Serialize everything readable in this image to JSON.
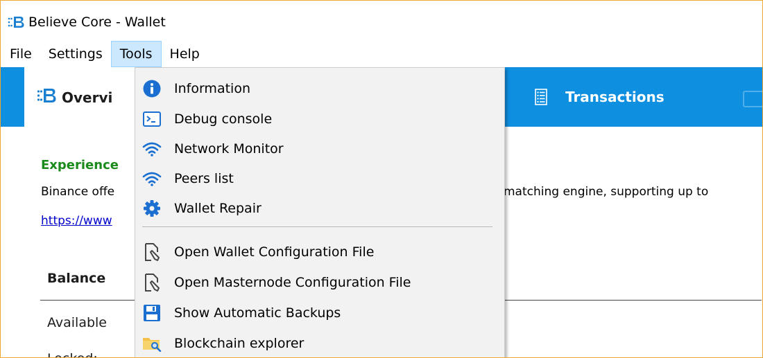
{
  "window": {
    "title": "Believe Core - Wallet"
  },
  "menubar": {
    "items": [
      {
        "label": "File"
      },
      {
        "label": "Settings"
      },
      {
        "label": "Tools"
      },
      {
        "label": "Help"
      }
    ]
  },
  "toolbar": {
    "overview_label": "Overvi",
    "transactions_label": "Transactions"
  },
  "content": {
    "promo_title": "Experience",
    "promo_text_left": "Binance offe",
    "promo_text_right": "matching engine, supporting up to",
    "promo_link": "https://www",
    "balance_header": "Balance",
    "available_label": "Available",
    "locked_label": "Locked:"
  },
  "tools_menu": {
    "items": [
      {
        "label": "Information",
        "icon": "info-icon"
      },
      {
        "label": "Debug console",
        "icon": "console-icon"
      },
      {
        "label": "Network Monitor",
        "icon": "wifi-icon"
      },
      {
        "label": "Peers list",
        "icon": "wifi-icon"
      },
      {
        "label": "Wallet Repair",
        "icon": "gear-icon"
      },
      {
        "label": "Open Wallet Configuration File",
        "icon": "file-edit-icon"
      },
      {
        "label": "Open Masternode Configuration File",
        "icon": "file-edit-icon"
      },
      {
        "label": "Show Automatic Backups",
        "icon": "floppy-icon"
      },
      {
        "label": "Blockchain explorer",
        "icon": "folder-search-icon"
      }
    ]
  },
  "colors": {
    "toolbar_blue": "#0f8fe0",
    "promo_green": "#1a8a1a",
    "link_blue": "#0000cc",
    "menu_highlight": "#cce8ff"
  }
}
